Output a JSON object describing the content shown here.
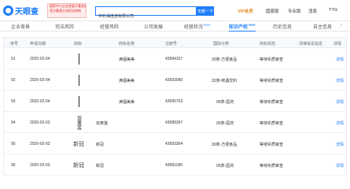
{
  "header": {
    "logo_text": "天眼查",
    "promo_lines": [
      "国家中小企业发展子基金旗下",
      "官方备案企业征信机构"
    ],
    "search_value": "中石油连连有限公司",
    "search_button": "天眼一下",
    "vip_label": "VIP会员",
    "nav_items": [
      "国家版",
      "专业版",
      "消息",
      "TYG"
    ]
  },
  "tabs": [
    {
      "label": "企业背景",
      "badge": ""
    },
    {
      "label": "司法风险",
      "badge": ""
    },
    {
      "label": "经营风险",
      "badge": ""
    },
    {
      "label": "公司发展",
      "badge": ""
    },
    {
      "label": "经营状况",
      "badge": "999+"
    },
    {
      "label": "知识产权",
      "badge": "999+"
    },
    {
      "label": "历史信息",
      "badge": ""
    },
    {
      "label": "自主信息",
      "badge": ""
    }
  ],
  "active_tab": "知识产权",
  "table": {
    "headers": [
      "序号",
      "申请日期",
      "商标",
      "商标名称",
      "注册号",
      "国际分类",
      "商标状态",
      "法律诉讼信息",
      "详情"
    ],
    "rows": [
      {
        "index": "91",
        "date": "2020-02-04",
        "logo": "bar",
        "name": "满福美美",
        "reg_no": "43994167",
        "category": "30类-方便食品",
        "status": "等待实质审查",
        "detail": "详情"
      },
      {
        "index": "92",
        "date": "2020-02-04",
        "logo": "bar",
        "name": "满福美美",
        "reg_no": "43993086",
        "category": "32类-啤酒饮料",
        "status": "等待实质审查",
        "detail": "详情"
      },
      {
        "index": "93",
        "date": "2020-02-04",
        "logo": "bar",
        "name": "满福美美",
        "reg_no": "43995753",
        "category": "05类-医药",
        "status": "等待实质审查",
        "detail": "详情"
      },
      {
        "index": "94",
        "date": "2020-02-03",
        "logo": "callig",
        "logo_text": "双黄莲",
        "name": "双黄莲",
        "reg_no": "43988397",
        "category": "05类-医药",
        "status": "等待实质审查",
        "detail": "详情"
      },
      {
        "index": "95",
        "date": "2020-02-03",
        "logo": "word",
        "logo_text": "新冠",
        "name": "新冠",
        "reg_no": "43993364",
        "category": "30类-方便食品",
        "status": "等待实质审查",
        "detail": "详情"
      },
      {
        "index": "96",
        "date": "2020-02-03",
        "logo": "word",
        "logo_text": "新冠",
        "name": "新冠",
        "reg_no": "43981180",
        "category": "05类-医药",
        "status": "等待实质审查",
        "detail": "详情"
      }
    ]
  },
  "colors": {
    "accent": "#1d7dfa",
    "vip": "#e08a1e",
    "promo": "#e02020"
  }
}
